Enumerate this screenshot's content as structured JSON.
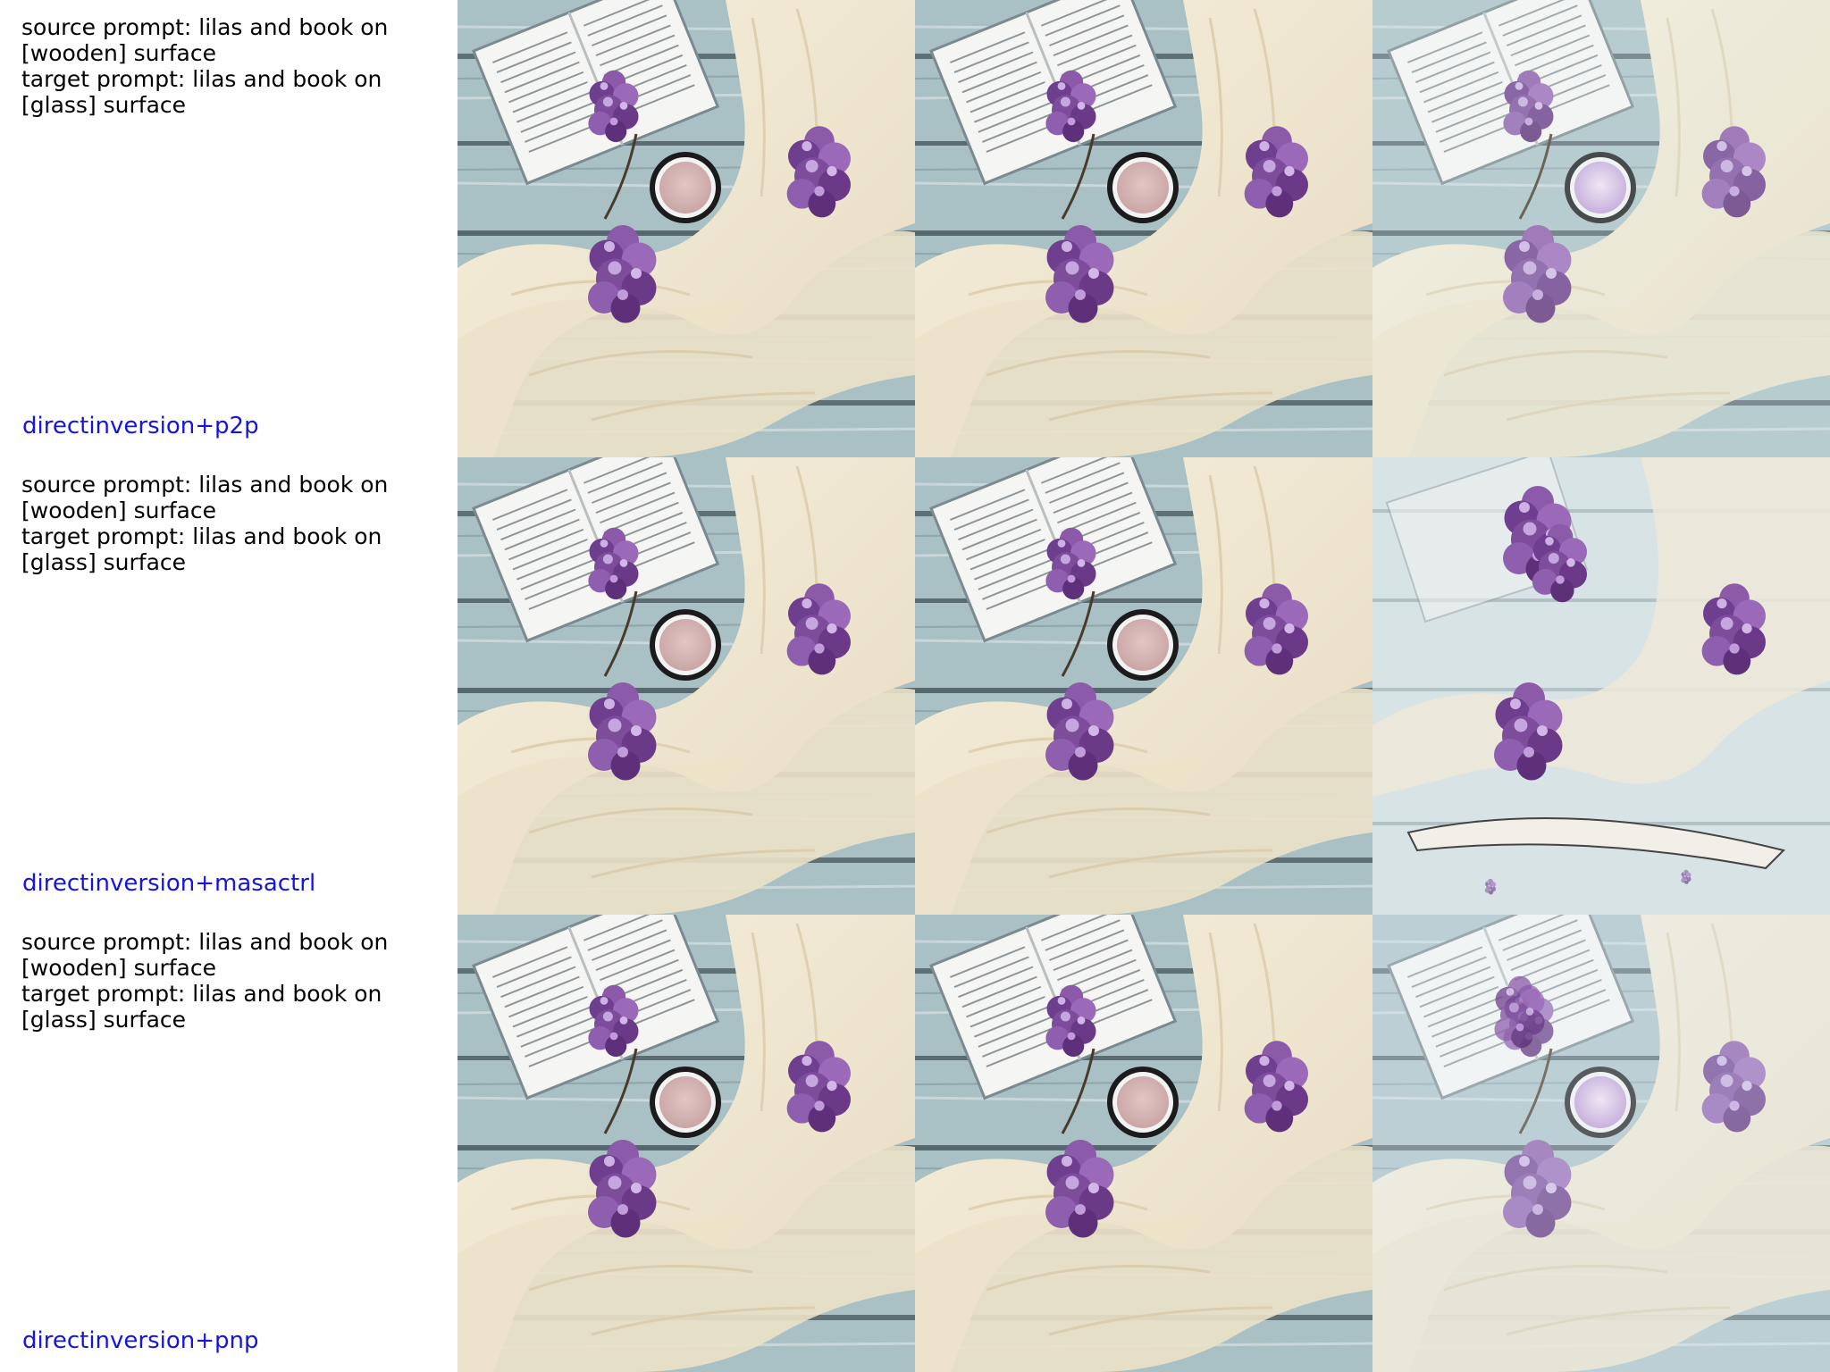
{
  "rows": [
    {
      "source_prompt": "source prompt: lilas and book on [wooden] surface",
      "target_prompt": "target prompt: lilas and book on [glass] surface",
      "method": "directinversion+p2p"
    },
    {
      "source_prompt": "source prompt: lilas and book on [wooden] surface",
      "target_prompt": "target prompt: lilas and book on [glass] surface",
      "method": "directinversion+masactrl"
    },
    {
      "source_prompt": "source prompt: lilas and book on [wooden] surface",
      "target_prompt": "target prompt: lilas and book on [glass] surface",
      "method": "directinversion+pnp"
    }
  ],
  "colors": {
    "method_label": "#1515e0",
    "wood": "#9fb8bd",
    "scarf": "#efe6d2",
    "lilac": "#7a4a9a",
    "book": "#f4f4f2"
  },
  "images": {
    "depicts": [
      "lilac-sprigs",
      "open-book",
      "mug",
      "cream-scarf",
      "wooden-planks"
    ]
  }
}
